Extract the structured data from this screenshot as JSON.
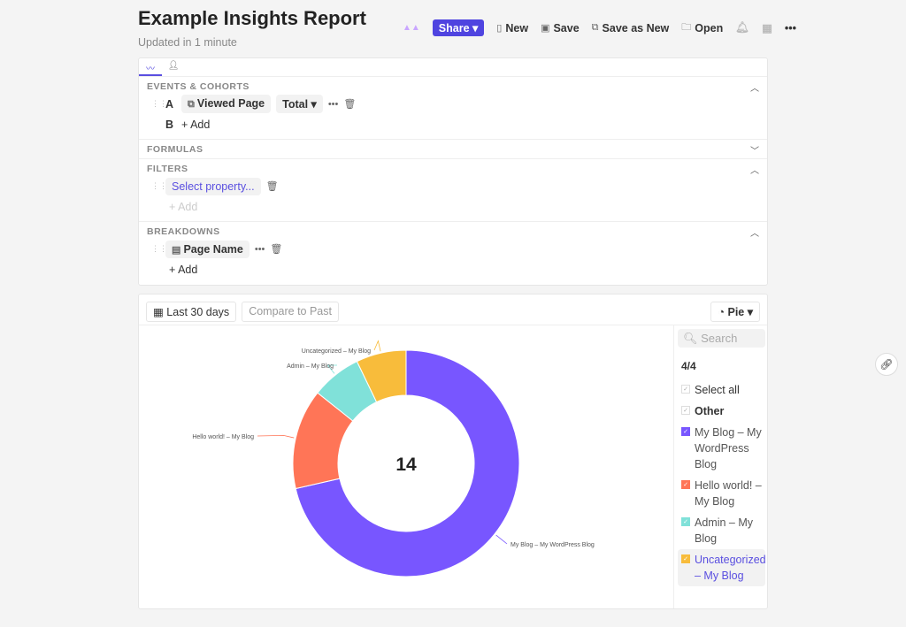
{
  "header": {
    "title": "Example Insights Report",
    "updated": "Updated in 1 minute",
    "toolbar": {
      "share": "Share ▾",
      "new": "New",
      "save": "Save",
      "save_as_new": "Save as New",
      "open": "Open"
    }
  },
  "query": {
    "events": {
      "title": "EVENTS & COHORTS",
      "rows": [
        {
          "letter": "A",
          "event": "Viewed Page",
          "measure": "Total ▾"
        },
        {
          "letter": "B",
          "add": "+ Add"
        }
      ]
    },
    "formulas": {
      "title": "FORMULAS"
    },
    "filters": {
      "title": "FILTERS",
      "select": "Select property...",
      "add": "+ Add"
    },
    "breakdowns": {
      "title": "BREAKDOWNS",
      "property": "Page Name",
      "add": "+ Add"
    }
  },
  "controls": {
    "date_range": "Last 30 days",
    "compare": "Compare to Past",
    "chart_type": "Pie ▾"
  },
  "legend": {
    "search_placeholder": "Search",
    "count": "4/4",
    "select_all": "Select all",
    "other": "Other",
    "items": [
      "My Blog – My WordPress Blog",
      "Hello world! – My Blog",
      "Admin – My Blog",
      "Uncategorized – My Blog"
    ]
  },
  "chart_data": {
    "type": "pie",
    "donut": true,
    "total_label": "14",
    "categories": [
      "My Blog – My WordPress Blog",
      "Hello world! – My Blog",
      "Admin – My Blog",
      "Uncategorized – My Blog"
    ],
    "values": [
      10,
      2,
      1,
      1
    ],
    "colors": [
      "#7856ff",
      "#ff7557",
      "#80e1d9",
      "#f8bc3b"
    ]
  }
}
